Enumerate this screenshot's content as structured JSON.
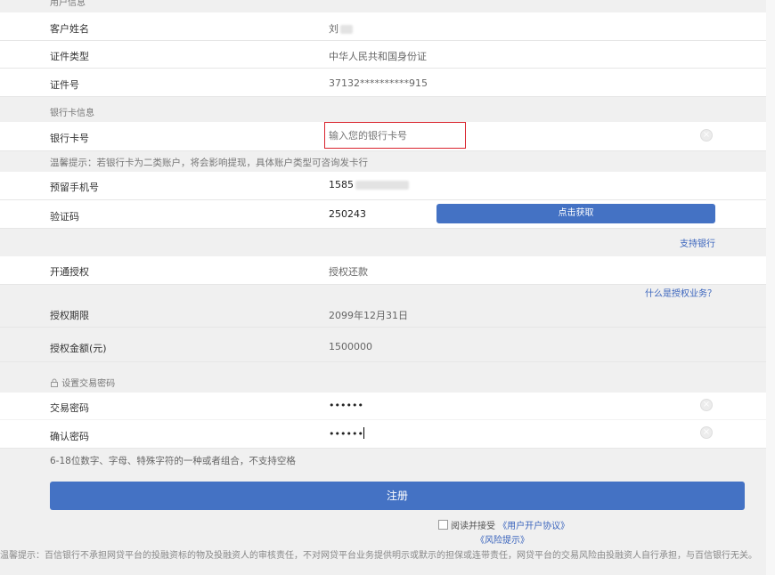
{
  "section_user": "用户信息",
  "name": {
    "label": "客户姓名",
    "value": "刘"
  },
  "id_type": {
    "label": "证件类型",
    "value": "中华人民共和国身份证"
  },
  "id_no": {
    "label": "证件号",
    "value": "37132**********915"
  },
  "section_bank": "银行卡信息",
  "bank_card": {
    "label": "银行卡号",
    "placeholder": "输入您的银行卡号"
  },
  "bank_tip": "温馨提示：若银行卡为二类账户，将会影响提现，具体账户类型可咨询发卡行",
  "phone": {
    "label": "预留手机号",
    "value": "1585"
  },
  "code": {
    "label": "验证码",
    "value": "250243",
    "button": "点击获取"
  },
  "support_bank_link": "支持银行",
  "auth": {
    "label": "开通授权",
    "value": "授权还款"
  },
  "what_is_auth_link": "什么是授权业务？",
  "auth_period": {
    "label": "授权期限",
    "value": "2099年12月31日"
  },
  "auth_amount": {
    "label": "授权金额(元)",
    "value": "1500000"
  },
  "section_pwd": "设置交易密码",
  "pwd": {
    "label": "交易密码",
    "value": "••••••"
  },
  "pwd_confirm": {
    "label": "确认密码",
    "value": "••••••"
  },
  "pwd_rule": "6-18位数字、字母、特殊字符的一种或者组合，不支持空格",
  "register_button": "注册",
  "agree_text": "阅读并接受",
  "user_agreement_link": "《用户开户协议》",
  "risk_link": "《风险提示》",
  "footer_tip": "温馨提示：百信银行不承担网贷平台的投融资标的物及投融资人的审核责任，不对网贷平台业务提供明示或默示的担保或连带责任，网贷平台的交易风险由投融资人自行承担，与百信银行无关。",
  "colors": {
    "primary": "#4472c4",
    "link": "#3a64bd",
    "highlight_border": "#d9232d"
  }
}
